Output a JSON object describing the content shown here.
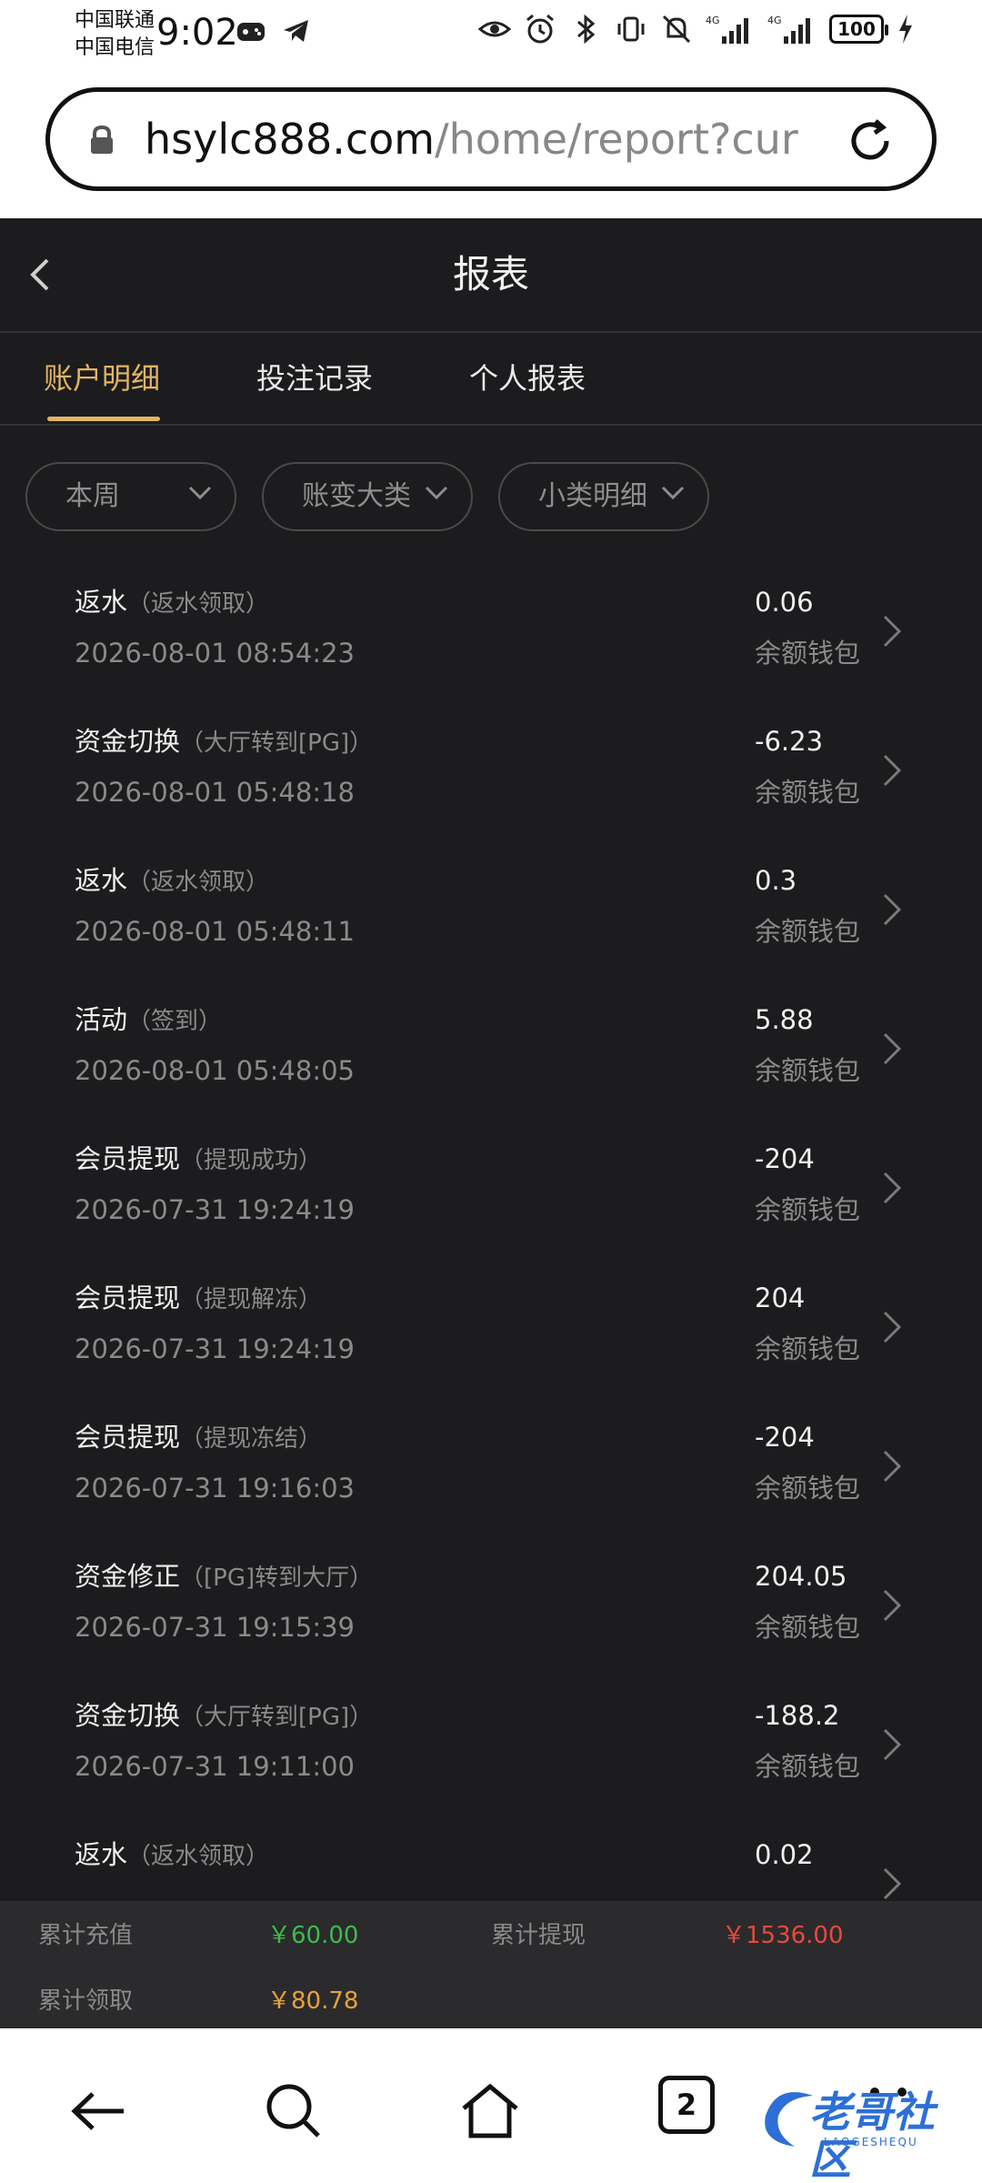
{
  "status_bar": {
    "carrier_1": "中国联通",
    "carrier_2": "中国电信",
    "time": "9:02",
    "network_1": "4G",
    "network_2": "4G",
    "battery": "100"
  },
  "browser": {
    "url_host": "hsylc888.com",
    "url_path": "/home/report?currer"
  },
  "header": {
    "title": "报表"
  },
  "tabs": [
    {
      "label": "账户明细",
      "active": true
    },
    {
      "label": "投注记录",
      "active": false
    },
    {
      "label": "个人报表",
      "active": false
    }
  ],
  "filters": [
    {
      "label": "本周"
    },
    {
      "label": "账变大类"
    },
    {
      "label": "小类明细"
    }
  ],
  "records": [
    {
      "type": "返水",
      "subtype": "（返水领取）",
      "time": "2026-08-01 08:54:23",
      "amount": "0.06",
      "wallet": "余额钱包"
    },
    {
      "type": "资金切换",
      "subtype": "（大厅转到[PG]）",
      "time": "2026-08-01 05:48:18",
      "amount": "-6.23",
      "wallet": "余额钱包"
    },
    {
      "type": "返水",
      "subtype": "（返水领取）",
      "time": "2026-08-01 05:48:11",
      "amount": "0.3",
      "wallet": "余额钱包"
    },
    {
      "type": "活动",
      "subtype": "（签到）",
      "time": "2026-08-01 05:48:05",
      "amount": "5.88",
      "wallet": "余额钱包"
    },
    {
      "type": "会员提现",
      "subtype": "（提现成功）",
      "time": "2026-07-31 19:24:19",
      "amount": "-204",
      "wallet": "余额钱包"
    },
    {
      "type": "会员提现",
      "subtype": "（提现解冻）",
      "time": "2026-07-31 19:24:19",
      "amount": "204",
      "wallet": "余额钱包"
    },
    {
      "type": "会员提现",
      "subtype": "（提现冻结）",
      "time": "2026-07-31 19:16:03",
      "amount": "-204",
      "wallet": "余额钱包"
    },
    {
      "type": "资金修正",
      "subtype": "（[PG]转到大厅）",
      "time": "2026-07-31 19:15:39",
      "amount": "204.05",
      "wallet": "余额钱包"
    },
    {
      "type": "资金切换",
      "subtype": "（大厅转到[PG]）",
      "time": "2026-07-31 19:11:00",
      "amount": "-188.2",
      "wallet": "余额钱包"
    },
    {
      "type": "返水",
      "subtype": "（返水领取）",
      "time": "",
      "amount": "0.02",
      "wallet": ""
    }
  ],
  "summary": {
    "recharge_label": "累计充值",
    "recharge_value": "￥60.00",
    "withdraw_label": "累计提现",
    "withdraw_value": "￥1536.00",
    "claim_label": "累计领取",
    "claim_value": "￥80.78"
  },
  "nav": {
    "tab_count": "2"
  },
  "watermark": {
    "text": "老哥社区",
    "sub": "LAOGESHEQU"
  }
}
